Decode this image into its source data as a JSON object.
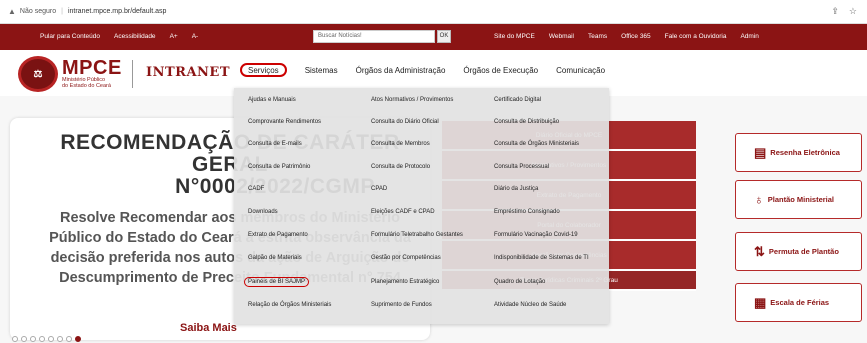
{
  "browser": {
    "security_text": "Não seguro",
    "url": "intranet.mpce.mp.br/default.asp"
  },
  "topbar": {
    "links_left": [
      "Pular para Conteúdo",
      "Acessibilidade",
      "A+",
      "A-"
    ],
    "search_placeholder": "Buscar Notícias!",
    "ok_label": "OK",
    "links_right": [
      "Site do MPCE",
      "Webmail",
      "Teams",
      "Office 365",
      "Fale com a Ouvidoria",
      "Admin"
    ]
  },
  "header": {
    "logo_big": "MPCE",
    "logo_small_1": "Ministério Público",
    "logo_small_2": "do Estado do Ceará",
    "intranet": "INTRANET",
    "nav": [
      "Serviços",
      "Sistemas",
      "Órgãos da Administração",
      "Órgãos de Execução",
      "Comunicação"
    ]
  },
  "slide": {
    "title_1": "RECOMENDAÇÃO DE CARÁTER GERAL",
    "title_2": "N°0002/2022/CGMP",
    "body_1": "Resolve Recomendar aos membros do Ministério",
    "body_2": "Público do Estado do Ceará a estrita observância da",
    "body_3": "decisão preferida nos autos da ação de Arguição de",
    "body_4": "Descumprimento de Preceito Fundamental n° 754",
    "saiba_mais": "Saiba Mais"
  },
  "redcol": [
    "Diário Oficial do MPCE",
    "Normativos / Provimentos",
    "Extrato de Pagamento",
    "Portal do Colaborador",
    "Gestão por Competências",
    "Teses Jurídicas Criminais 2º Grau"
  ],
  "quick": [
    {
      "label": "Resenha Eletrônica",
      "icon": "document-icon"
    },
    {
      "label": "Plantão Ministerial",
      "icon": "ribbon-icon"
    },
    {
      "label": "Permuta de Plantão",
      "icon": "sort-icon"
    },
    {
      "label": "Escala de Férias",
      "icon": "calendar-icon"
    }
  ],
  "dropdown": {
    "col1": [
      "Ajudas e Manuais",
      "Comprovante Rendimentos",
      "Consulta de E-mails",
      "Consulta de Patrimônio",
      "CADF",
      "Downloads",
      "Extrato de Pagamento",
      "Galpão de Materiais",
      "Painéis de BI SAJMP",
      "Relação de Órgãos Ministeriais"
    ],
    "col2": [
      "Atos Normativos / Provimentos",
      "Consulta do Diário Oficial",
      "Consulta de Membros",
      "Consulta de Protocolo",
      "CPAD",
      "Eleições CADF e CPAD",
      "Formulário Teletrabalho Gestantes",
      "Gestão por Competências",
      "Planejamento Estratégico",
      "Suprimento de Fundos"
    ],
    "col3": [
      "Certificado Digital",
      "Consulta de Distribuição",
      "Consulta de Órgãos Ministeriais",
      "Consulta Processual",
      "Diário da Justiça",
      "Empréstimo Consignado",
      "Formulário Vacinação Covid-19",
      "Indisponibilidade de Sistemas de TI",
      "Quadro de Lotação",
      "Atividade Núcleo de Saúde"
    ]
  }
}
